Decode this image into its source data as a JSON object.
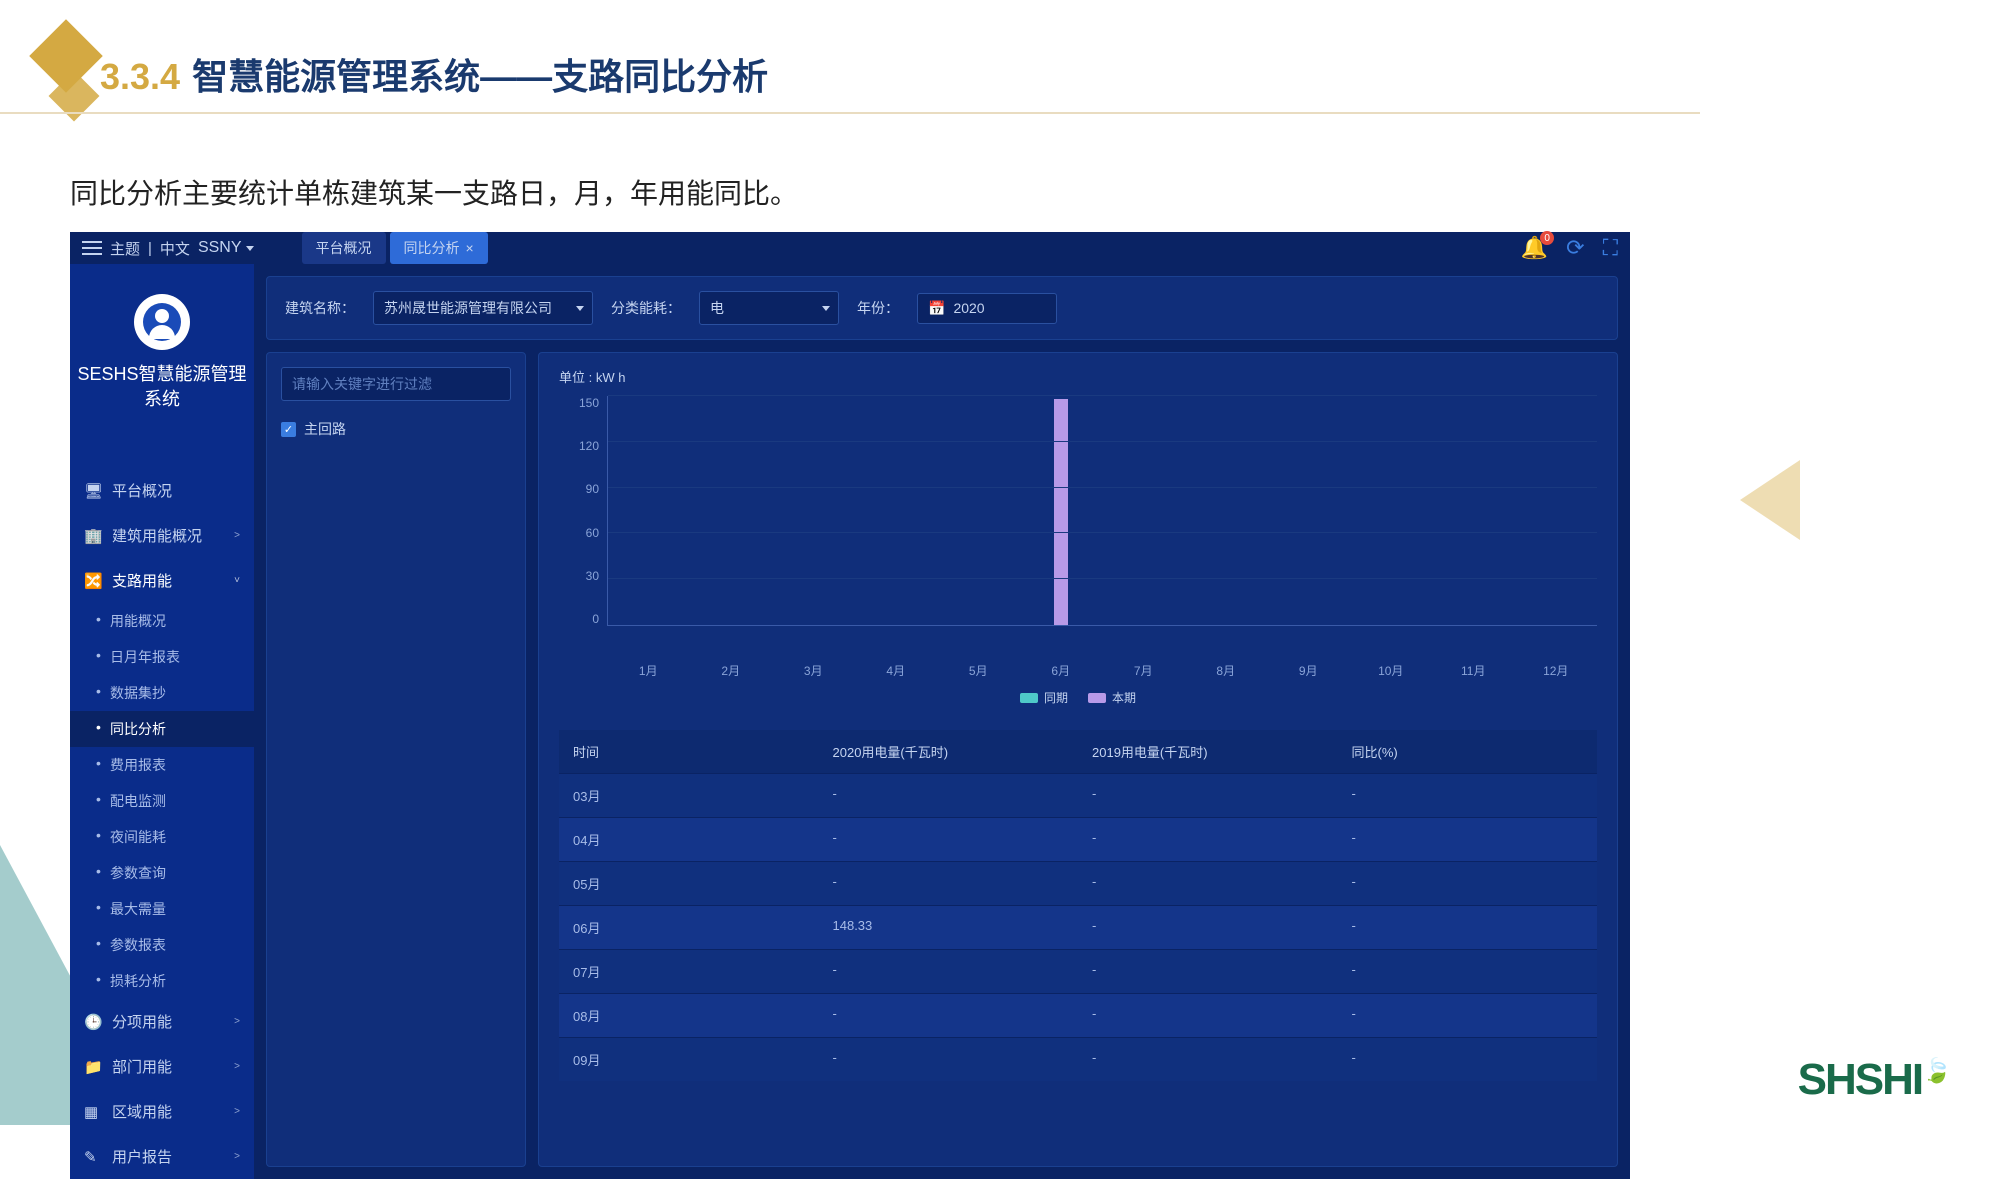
{
  "slide": {
    "section_num": "3.3.4",
    "title": "智慧能源管理系统——支路同比分析",
    "subtitle": "同比分析主要统计单栋建筑某一支路日，月，年用能同比。",
    "logo": "SHSHI"
  },
  "topbar": {
    "theme": "主题",
    "lang": "中文",
    "tenant": "SSNY",
    "tabs": [
      {
        "label": "平台概况",
        "active": false
      },
      {
        "label": "同比分析",
        "active": true,
        "closable": true
      }
    ],
    "badge": "0"
  },
  "sidebar": {
    "system_name": "SESHS智慧能源管理系统",
    "items": [
      {
        "label": "平台概况",
        "icon": "monitor"
      },
      {
        "label": "建筑用能概况",
        "icon": "building",
        "expandable": true
      },
      {
        "label": "支路用能",
        "icon": "branch",
        "expandable": true,
        "expanded": true,
        "children": [
          {
            "label": "用能概况"
          },
          {
            "label": "日月年报表"
          },
          {
            "label": "数据集抄"
          },
          {
            "label": "同比分析",
            "active": true
          },
          {
            "label": "费用报表"
          },
          {
            "label": "配电监测"
          },
          {
            "label": "夜间能耗"
          },
          {
            "label": "参数查询"
          },
          {
            "label": "最大需量"
          },
          {
            "label": "参数报表"
          },
          {
            "label": "损耗分析"
          }
        ]
      },
      {
        "label": "分项用能",
        "icon": "clock",
        "expandable": true
      },
      {
        "label": "部门用能",
        "icon": "folder",
        "expandable": true
      },
      {
        "label": "区域用能",
        "icon": "grid",
        "expandable": true
      },
      {
        "label": "用户报告",
        "icon": "edit",
        "expandable": true
      }
    ]
  },
  "filters": {
    "building_label": "建筑名称：",
    "building_value": "苏州晟世能源管理有限公司",
    "category_label": "分类能耗：",
    "category_value": "电",
    "year_label": "年份：",
    "year_value": "2020"
  },
  "tree": {
    "search_placeholder": "请输入关键字进行过滤",
    "root": "主回路"
  },
  "chart_data": {
    "type": "bar",
    "unit_label": "单位 : kW h",
    "categories": [
      "1月",
      "2月",
      "3月",
      "4月",
      "5月",
      "6月",
      "7月",
      "8月",
      "9月",
      "10月",
      "11月",
      "12月"
    ],
    "series": [
      {
        "name": "同期",
        "color": "#4fc9c9",
        "values": [
          0,
          0,
          0,
          0,
          0,
          0,
          0,
          0,
          0,
          0,
          0,
          0
        ]
      },
      {
        "name": "本期",
        "color": "#b89ae8",
        "values": [
          0,
          0,
          0,
          0,
          0,
          148.33,
          0,
          0,
          0,
          0,
          0,
          0
        ]
      }
    ],
    "y_ticks": [
      150,
      120,
      90,
      60,
      30,
      0
    ],
    "ylim": [
      0,
      150
    ]
  },
  "table": {
    "headers": [
      "时间",
      "2020用电量(千瓦时)",
      "2019用电量(千瓦时)",
      "同比(%)"
    ],
    "rows": [
      {
        "time": "03月",
        "cur": "-",
        "prev": "-",
        "yoy": "-"
      },
      {
        "time": "04月",
        "cur": "-",
        "prev": "-",
        "yoy": "-"
      },
      {
        "time": "05月",
        "cur": "-",
        "prev": "-",
        "yoy": "-"
      },
      {
        "time": "06月",
        "cur": "148.33",
        "prev": "-",
        "yoy": "-"
      },
      {
        "time": "07月",
        "cur": "-",
        "prev": "-",
        "yoy": "-"
      },
      {
        "time": "08月",
        "cur": "-",
        "prev": "-",
        "yoy": "-"
      },
      {
        "time": "09月",
        "cur": "-",
        "prev": "-",
        "yoy": "-"
      }
    ]
  }
}
